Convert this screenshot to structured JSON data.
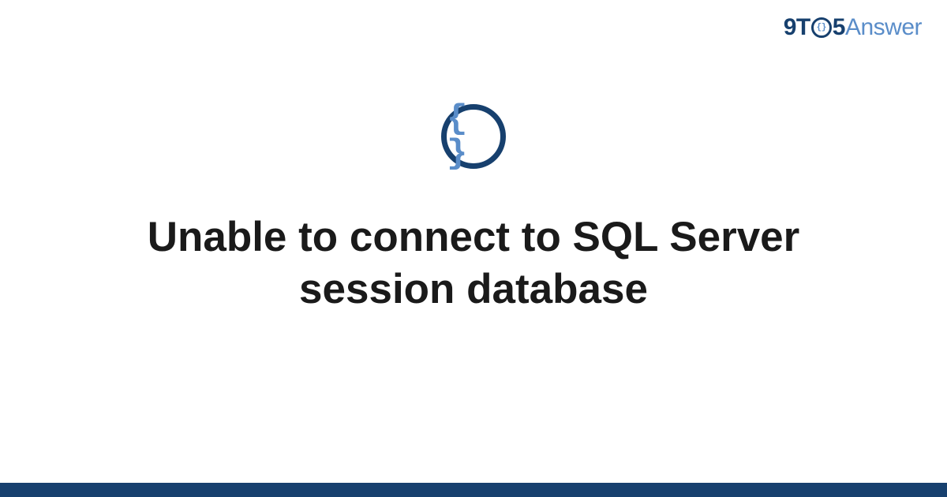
{
  "logo": {
    "part1": "9T",
    "inner": "{}",
    "part2": "5",
    "part3": "Answer"
  },
  "icon": {
    "glyph": "{ }"
  },
  "title": "Unable to connect to SQL Server session database"
}
